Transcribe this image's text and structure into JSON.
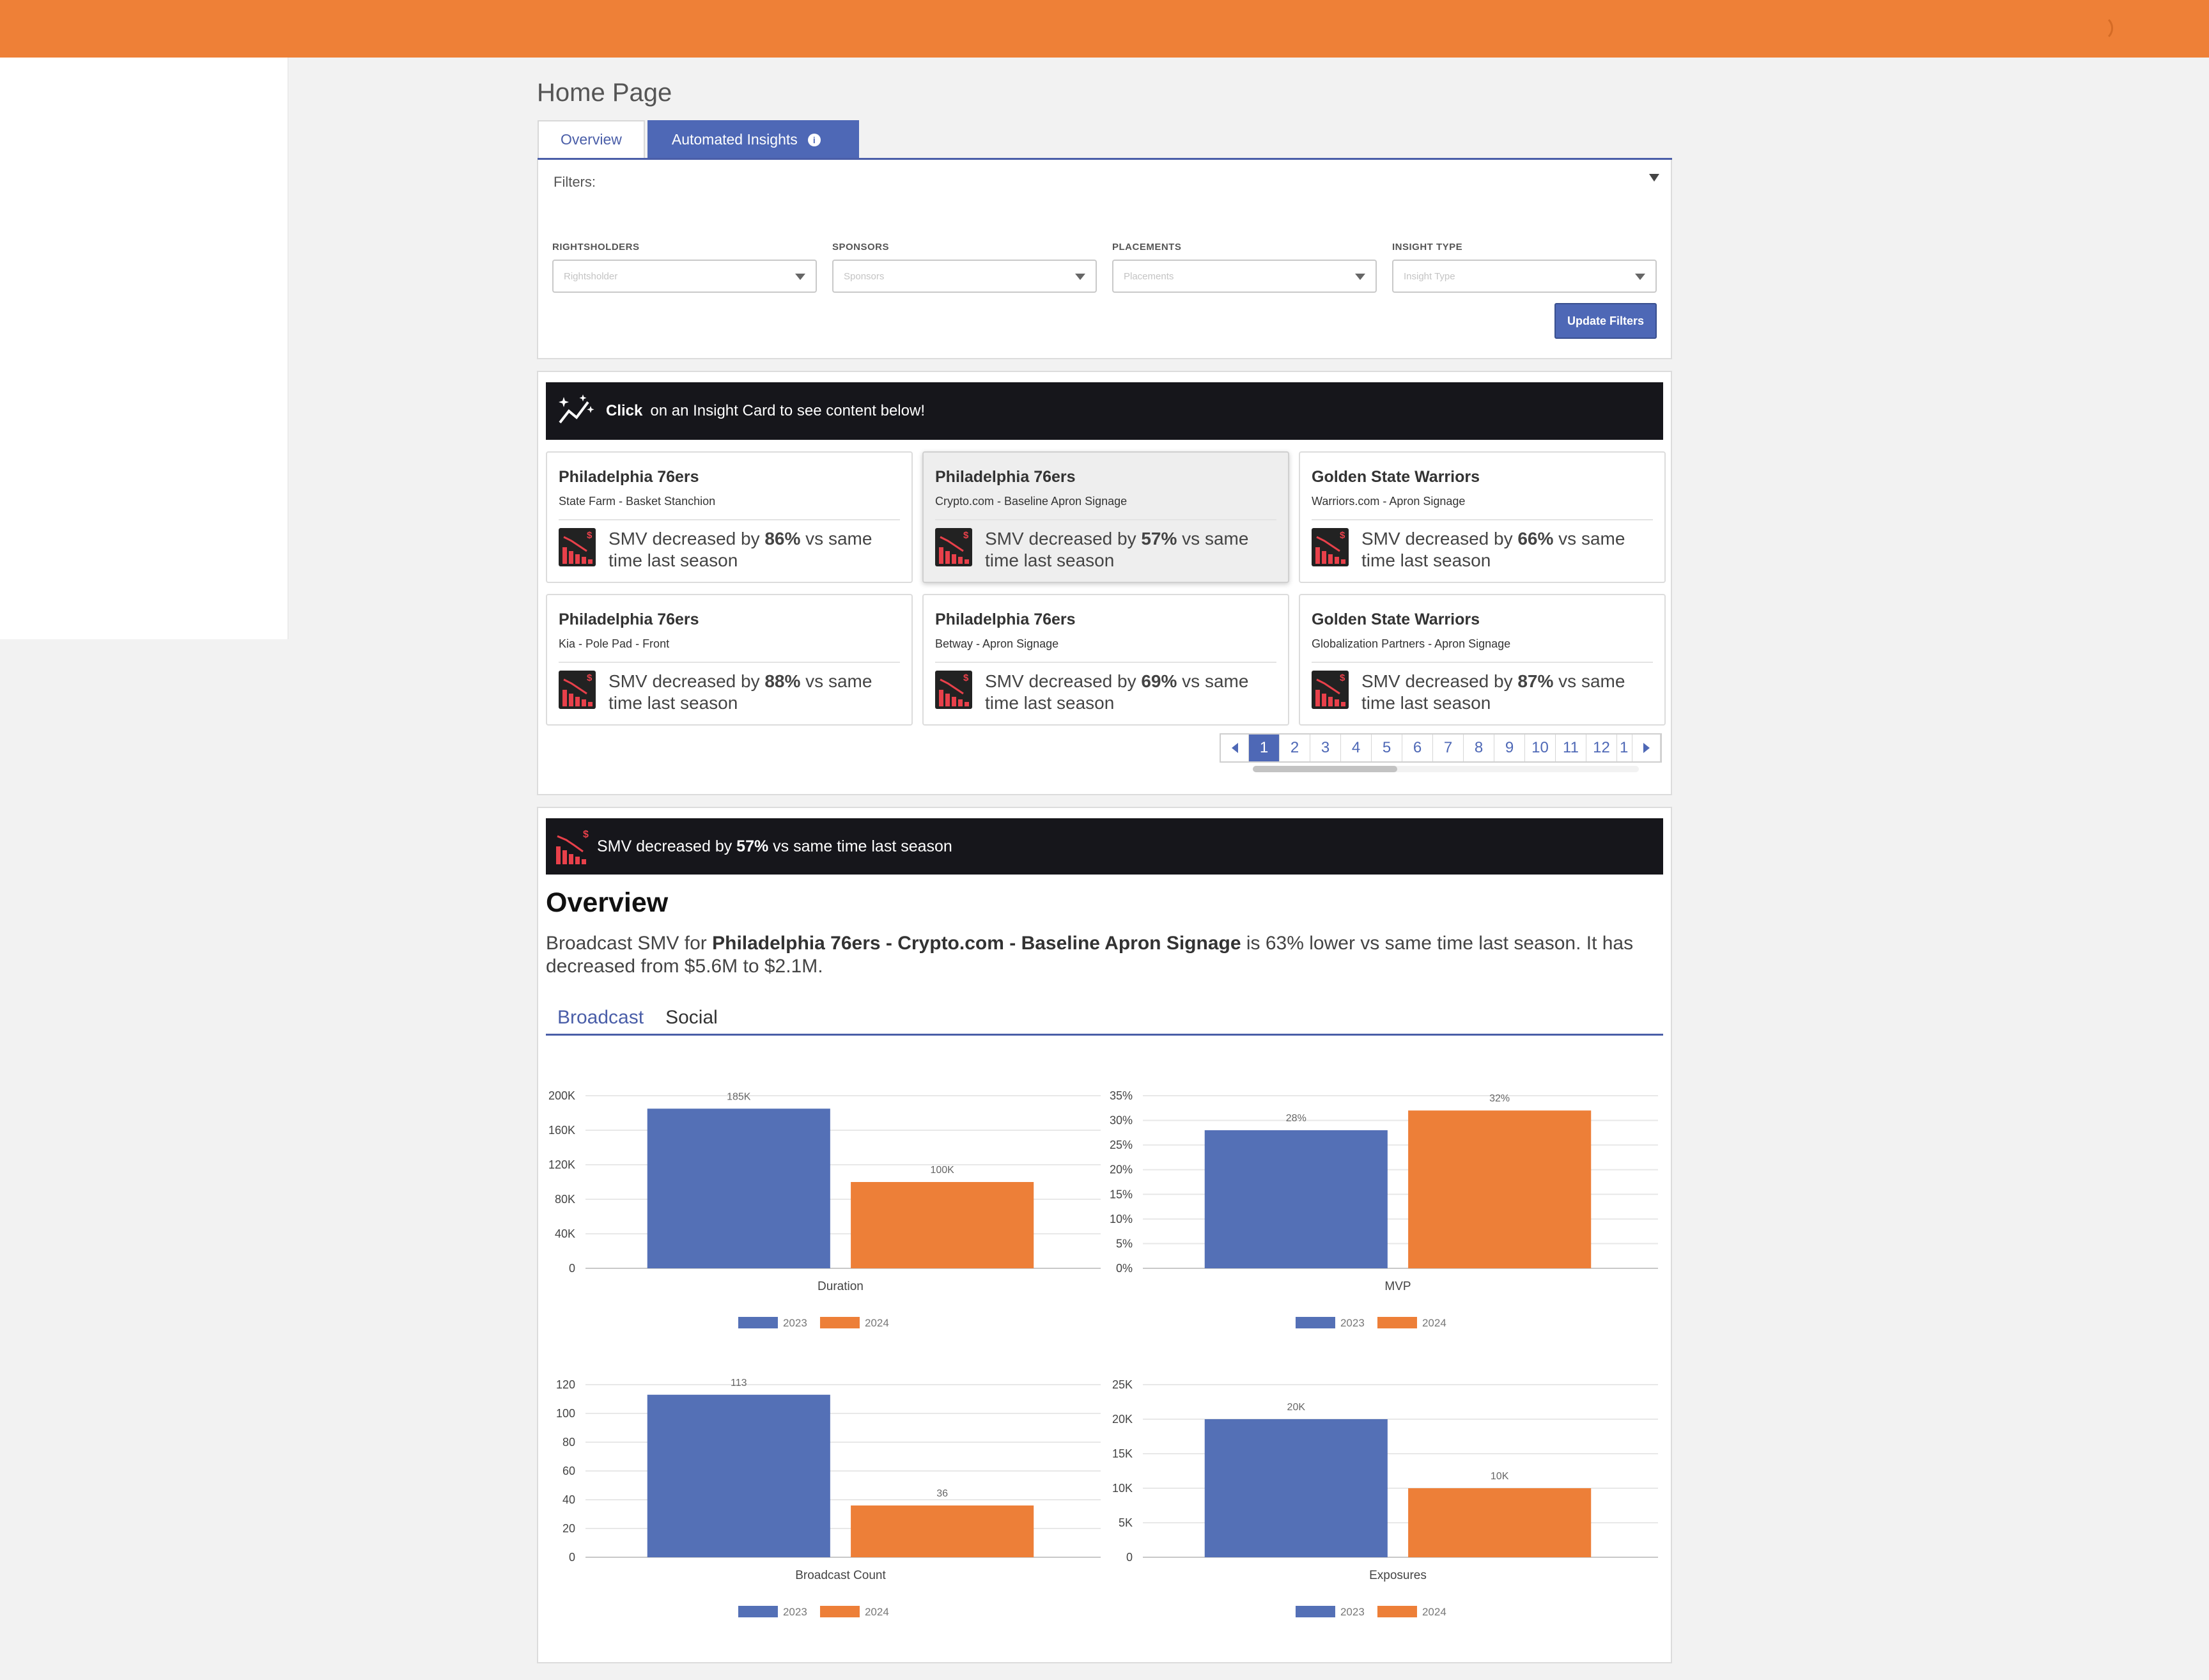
{
  "page": {
    "title": "Home Page"
  },
  "tabs": [
    {
      "label": "Overview"
    },
    {
      "label": "Automated Insights"
    }
  ],
  "filters": {
    "label": "Filters:",
    "fields": [
      {
        "label": "RIGHTSHOLDERS",
        "placeholder": "Rightsholder"
      },
      {
        "label": "SPONSORS",
        "placeholder": "Sponsors"
      },
      {
        "label": "PLACEMENTS",
        "placeholder": "Placements"
      },
      {
        "label": "INSIGHT TYPE",
        "placeholder": "Insight Type"
      }
    ],
    "update_label": "Update Filters"
  },
  "insights": {
    "banner_bold": "Click",
    "banner_text": "on an Insight Card to see content below!",
    "cards": [
      {
        "team": "Philadelphia 76ers",
        "sub": "State Farm - Basket Stanchion",
        "pre": "SMV decreased by ",
        "pct": "86%",
        "post": " vs same time last season"
      },
      {
        "team": "Philadelphia 76ers",
        "sub": "Crypto.com - Baseline Apron Signage",
        "pre": "SMV decreased by ",
        "pct": "57%",
        "post": " vs same time last season"
      },
      {
        "team": "Golden State Warriors",
        "sub": "Warriors.com - Apron Signage",
        "pre": "SMV decreased by ",
        "pct": "66%",
        "post": " vs same time last season"
      },
      {
        "team": "Philadelphia 76ers",
        "sub": "Kia - Pole Pad - Front",
        "pre": "SMV decreased by ",
        "pct": "88%",
        "post": " vs same time last season"
      },
      {
        "team": "Philadelphia 76ers",
        "sub": "Betway - Apron Signage",
        "pre": "SMV decreased by ",
        "pct": "69%",
        "post": " vs same time last season"
      },
      {
        "team": "Golden State Warriors",
        "sub": "Globalization Partners - Apron Signage",
        "pre": "SMV decreased by ",
        "pct": "87%",
        "post": " vs same time last season"
      }
    ],
    "pages": [
      "1",
      "2",
      "3",
      "4",
      "5",
      "6",
      "7",
      "8",
      "9",
      "10",
      "11",
      "12",
      "1"
    ],
    "current_page": "1"
  },
  "detail": {
    "banner_pre": "SMV decreased by ",
    "banner_pct": "57%",
    "banner_post": " vs same time last season",
    "overview_title": "Overview",
    "overview_pre": "Broadcast SMV for ",
    "overview_bold": "Philadelphia 76ers - Crypto.com - Baseline Apron Signage",
    "overview_post": " is 63% lower vs same time last season. It has decreased from $5.6M to $2.1M.",
    "subtabs": [
      "Broadcast",
      "Social"
    ],
    "active_subtab": "Broadcast"
  },
  "colors": {
    "accent": "#ee8037",
    "primary": "#4e68b6",
    "series_2023": "#5470b6",
    "series_2024": "#ed7f38",
    "banner": "#16161b"
  },
  "icons": {
    "insight": "sparkle-trend-icon",
    "card": "declining-bars-dollar-icon"
  },
  "chart_data": [
    {
      "type": "bar",
      "categories": [
        "Duration"
      ],
      "series": [
        {
          "name": "2023",
          "values": [
            185000
          ]
        },
        {
          "name": "2024",
          "values": [
            100000
          ]
        }
      ],
      "data_labels": [
        "185K",
        "100K"
      ],
      "yticks": [
        "0",
        "40K",
        "80K",
        "120K",
        "160K",
        "200K"
      ],
      "ylim": [
        0,
        200000
      ],
      "legend": "bottom"
    },
    {
      "type": "bar",
      "categories": [
        "MVP"
      ],
      "series": [
        {
          "name": "2023",
          "values": [
            28
          ]
        },
        {
          "name": "2024",
          "values": [
            32
          ]
        }
      ],
      "data_labels": [
        "28%",
        "32%"
      ],
      "yticks": [
        "0%",
        "5%",
        "10%",
        "15%",
        "20%",
        "25%",
        "30%",
        "35%"
      ],
      "ylim": [
        0,
        35
      ],
      "legend": "bottom"
    },
    {
      "type": "bar",
      "categories": [
        "Broadcast Count"
      ],
      "series": [
        {
          "name": "2023",
          "values": [
            113
          ]
        },
        {
          "name": "2024",
          "values": [
            36
          ]
        }
      ],
      "data_labels": [
        "113",
        "36"
      ],
      "yticks": [
        "0",
        "20",
        "40",
        "60",
        "80",
        "100",
        "120"
      ],
      "ylim": [
        0,
        120
      ],
      "legend": "bottom"
    },
    {
      "type": "bar",
      "categories": [
        "Exposures"
      ],
      "series": [
        {
          "name": "2023",
          "values": [
            20000
          ]
        },
        {
          "name": "2024",
          "values": [
            10000
          ]
        }
      ],
      "data_labels": [
        "20K",
        "10K"
      ],
      "yticks": [
        "0",
        "5K",
        "10K",
        "15K",
        "20K",
        "25K"
      ],
      "ylim": [
        0,
        25000
      ],
      "legend": "bottom"
    }
  ]
}
